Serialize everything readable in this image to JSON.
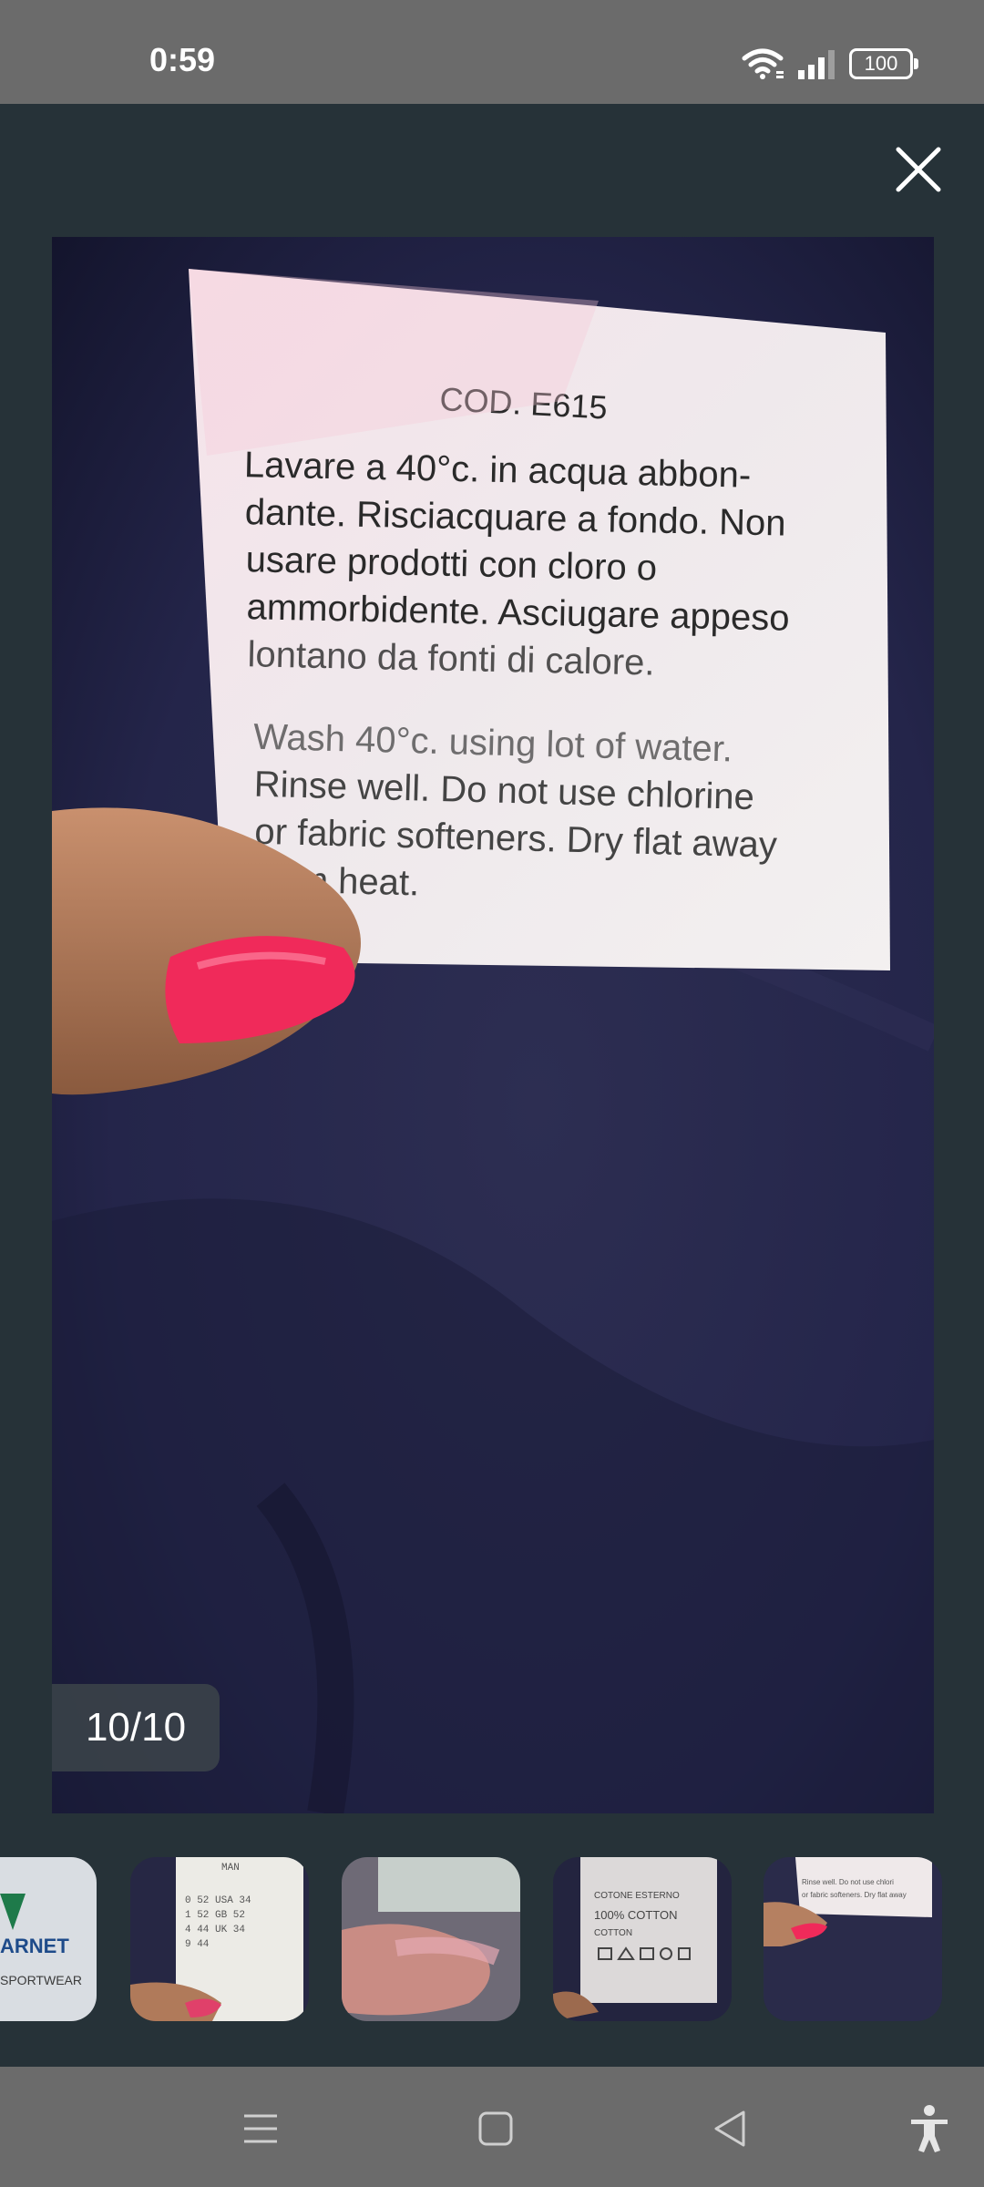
{
  "status_bar": {
    "time": "0:59",
    "battery": "100",
    "icons": [
      "wifi-icon",
      "signal-icon",
      "battery-icon"
    ]
  },
  "viewer": {
    "close_icon": "close-icon",
    "counter": "10/10"
  },
  "label": {
    "code": "COD. E615",
    "italian_lines": [
      "Lavare a 40°c. in acqua abbon-",
      "dante. Risciacquare a fondo. Non",
      "usare prodotti con cloro o",
      "ammorbidente. Asciugare appeso",
      "lontano da fonti di calore."
    ],
    "english_lines": [
      "Wash 40°c. using lot of water.",
      "Rinse well. Do not use chlorine",
      "or fabric softeners. Dry flat away",
      "from heat."
    ]
  },
  "thumbnails": {
    "t1_lines": [
      "ARNET",
      "SPORTWEAR"
    ],
    "t2_lines": [
      "MAN",
      "0  52    USA 34",
      "1  52    GB 52",
      "4  44    UK 34",
      "9  44"
    ],
    "t4_lines": [
      "COTONE ESTERNO",
      "100% COTTON",
      "COTTON"
    ],
    "t5_lines": [
      "Rinse well. Do not use chlori",
      "or fabric softeners. Dry flat away"
    ]
  },
  "nav_bar": {
    "icons": [
      "menu-icon",
      "home-icon",
      "back-icon",
      "accessibility-icon"
    ]
  },
  "colors": {
    "background": "#263238",
    "system_bars": "#6b6b6b",
    "label_paper": "#f1ecec",
    "fabric": "#2a2b4a",
    "nail": "#f02a5a"
  }
}
